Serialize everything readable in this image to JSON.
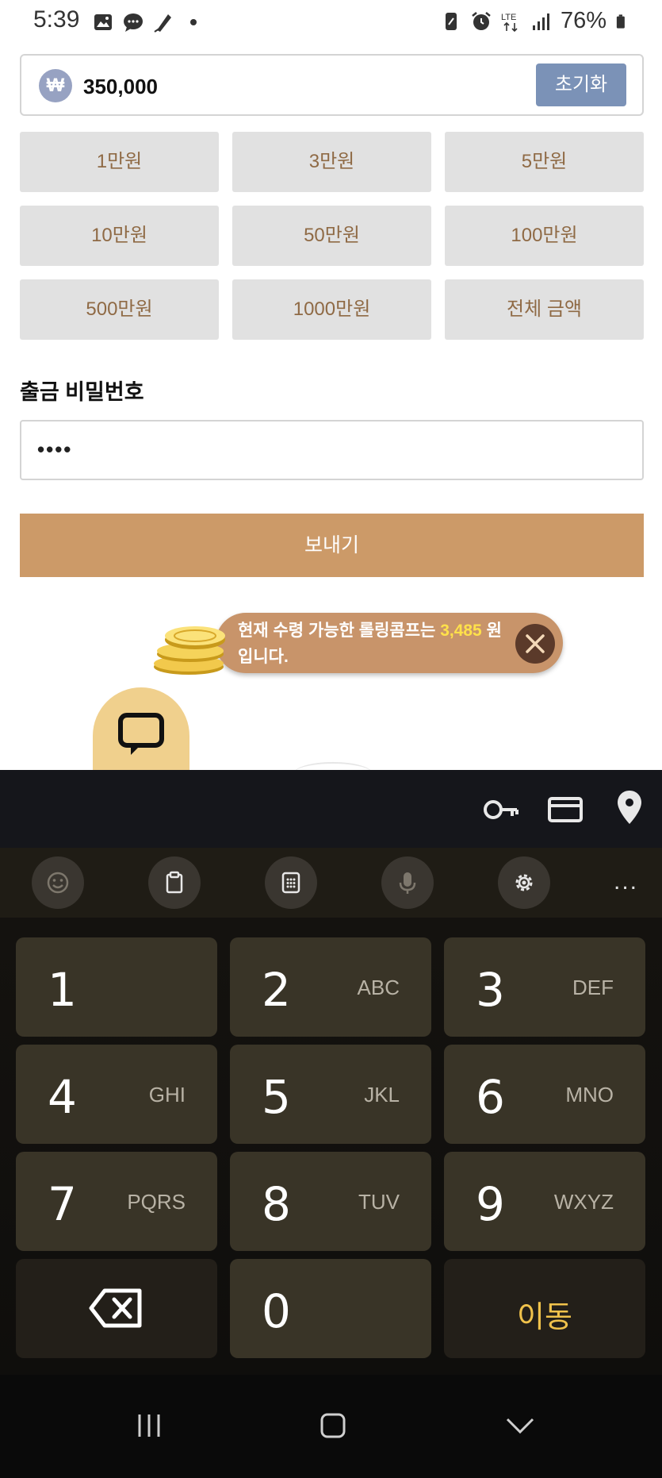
{
  "status_bar": {
    "time": "5:39",
    "battery_percent": "76%",
    "network": "LTE",
    "icons": [
      "gallery-icon",
      "message-icon",
      "pen-icon",
      "dot-icon",
      "nfc-icon",
      "alarm-icon",
      "lte-icon",
      "signal-icon",
      "battery-icon"
    ]
  },
  "amount": {
    "currency_symbol": "₩",
    "value": "350,000",
    "reset_label": "초기화"
  },
  "quick_amounts": [
    "1만원",
    "3만원",
    "5만원",
    "10만원",
    "50만원",
    "100만원",
    "500만원",
    "1000만원",
    "전체 금액"
  ],
  "password": {
    "label": "출금 비밀번호",
    "value": "••••"
  },
  "send_label": "보내기",
  "notice": {
    "text_before": "현재 수령 가능한 롤링콤프는 ",
    "amount": "3,485",
    "text_after": " 원 입니다."
  },
  "keyboard": {
    "top_icons": [
      "key-icon",
      "card-icon",
      "location-icon"
    ],
    "toolbar_icons": [
      "emoji-icon",
      "clipboard-icon",
      "keypad-icon",
      "mic-icon",
      "settings-icon",
      "more-icon"
    ],
    "keys": [
      {
        "num": "1",
        "letters": ""
      },
      {
        "num": "2",
        "letters": "ABC"
      },
      {
        "num": "3",
        "letters": "DEF"
      },
      {
        "num": "4",
        "letters": "GHI"
      },
      {
        "num": "5",
        "letters": "JKL"
      },
      {
        "num": "6",
        "letters": "MNO"
      },
      {
        "num": "7",
        "letters": "PQRS"
      },
      {
        "num": "8",
        "letters": "TUV"
      },
      {
        "num": "9",
        "letters": "WXYZ"
      },
      {
        "num": "0",
        "letters": ""
      }
    ],
    "go_label": "이동",
    "more_label": "..."
  },
  "colors": {
    "accent": "#cc9a68",
    "reset_button": "#7b92b7",
    "quick_button_text": "#8f6a45",
    "notice_highlight": "#ffe14a",
    "go_key_text": "#f0c24b"
  }
}
